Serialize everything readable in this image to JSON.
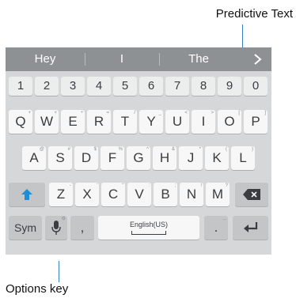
{
  "callouts": {
    "predictive": "Predictive Text",
    "options": "Options key"
  },
  "prediction": {
    "words": [
      "Hey",
      "I",
      "The"
    ],
    "expand_icon": "chevron-right-icon"
  },
  "rows": {
    "numbers": [
      "1",
      "2",
      "3",
      "4",
      "5",
      "6",
      "7",
      "8",
      "9",
      "0"
    ],
    "qwerty": [
      {
        "label": "Q",
        "hint": "+"
      },
      {
        "label": "W",
        "hint": "×"
      },
      {
        "label": "E",
        "hint": "÷"
      },
      {
        "label": "R",
        "hint": "="
      },
      {
        "label": "T",
        "hint": "/"
      },
      {
        "label": "Y",
        "hint": "_"
      },
      {
        "label": "U",
        "hint": "<"
      },
      {
        "label": "I",
        "hint": ">"
      },
      {
        "label": "O",
        "hint": "["
      },
      {
        "label": "P",
        "hint": "]"
      }
    ],
    "asdf": [
      {
        "label": "A",
        "hint": "@"
      },
      {
        "label": "S",
        "hint": "#"
      },
      {
        "label": "D",
        "hint": "$"
      },
      {
        "label": "F",
        "hint": "%"
      },
      {
        "label": "G",
        "hint": "^"
      },
      {
        "label": "H",
        "hint": "&"
      },
      {
        "label": "J",
        "hint": "*"
      },
      {
        "label": "K",
        "hint": "("
      },
      {
        "label": "L",
        "hint": ")"
      }
    ],
    "zxcv": [
      {
        "label": "Z",
        "hint": "-"
      },
      {
        "label": "X",
        "hint": "'"
      },
      {
        "label": "C",
        "hint": "\""
      },
      {
        "label": "V",
        "hint": ":"
      },
      {
        "label": "B",
        "hint": ";"
      },
      {
        "label": "N",
        "hint": "!"
      },
      {
        "label": "M",
        "hint": "?"
      }
    ]
  },
  "bottom": {
    "sym": "Sym",
    "comma": ",",
    "space": "English(US)",
    "period": ".",
    "period_hint": "..."
  },
  "icons": {
    "shift": "shift-arrow-icon",
    "backspace": "backspace-icon",
    "options": "microphone-icon",
    "enter": "enter-icon"
  },
  "colors": {
    "prediction_bar": "#8e9193",
    "keyboard_bg": "#d6d7d8",
    "shift_accent": "#1e8fd6",
    "callout_line": "#3a7fc0"
  }
}
